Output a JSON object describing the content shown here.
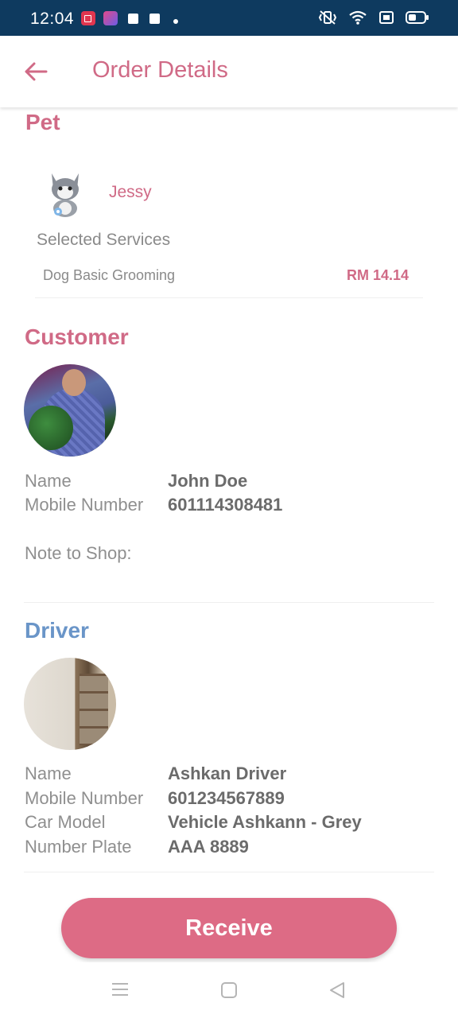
{
  "status_bar": {
    "time": "12:04"
  },
  "header": {
    "title": "Order Details",
    "back_icon": "arrow-left-icon"
  },
  "pet": {
    "section_title": "Pet",
    "name": "Jessy",
    "selected_services_label": "Selected Services",
    "services": [
      {
        "name": "Dog Basic Grooming",
        "price": "RM 14.14"
      }
    ]
  },
  "customer": {
    "section_title": "Customer",
    "name_label": "Name",
    "name": "John Doe",
    "mobile_label": "Mobile Number",
    "mobile": "601114308481",
    "note_label": "Note to Shop:"
  },
  "driver": {
    "section_title": "Driver",
    "name_label": "Name",
    "name": "Ashkan Driver",
    "mobile_label": "Mobile Number",
    "mobile": "601234567889",
    "car_label": "Car Model",
    "car": "Vehicle Ashkann - Grey",
    "plate_label": "Number Plate",
    "plate": "AAA 8889"
  },
  "actions": {
    "receive_label": "Receive"
  },
  "colors": {
    "status_bar": "#0e3a5f",
    "accent_pink": "#d06a86",
    "driver_blue": "#6a95c8",
    "button": "#dd6b85"
  }
}
